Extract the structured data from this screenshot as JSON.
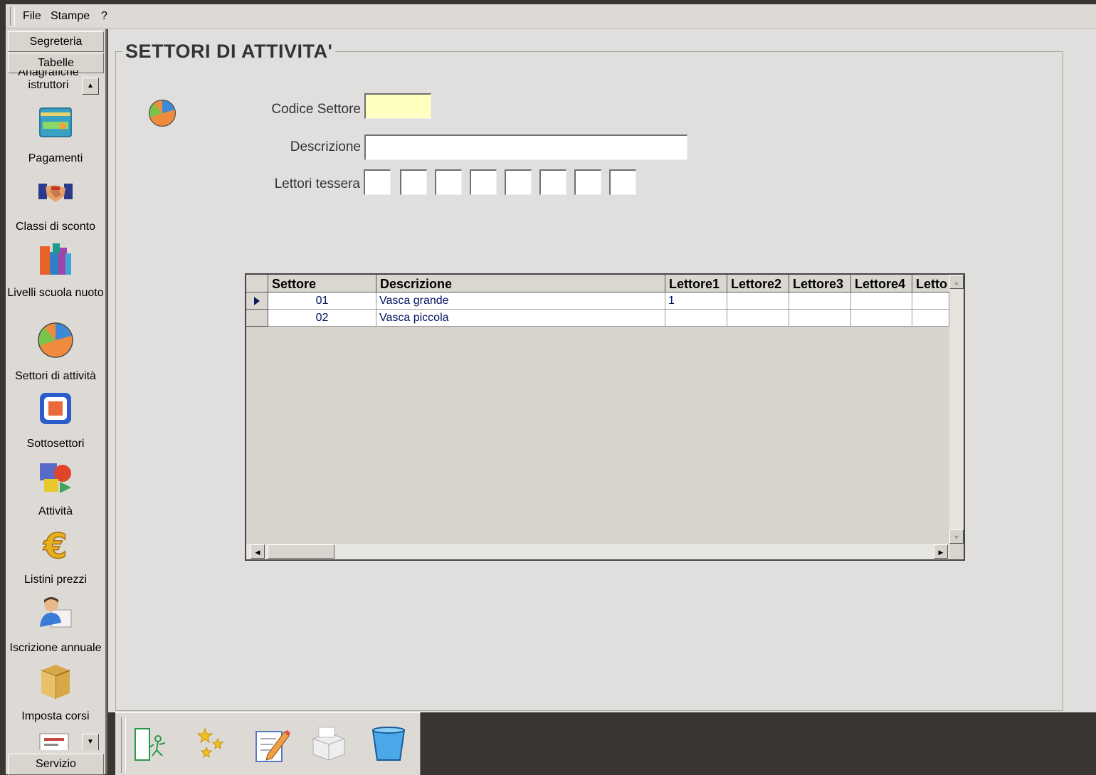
{
  "menu": {
    "items": [
      "File",
      "Stampe",
      "?"
    ]
  },
  "sidebar": {
    "top_groups": [
      "Segreteria",
      "Tabelle"
    ],
    "partial_item": "Anagrafiche istruttori",
    "items": [
      {
        "label": "Pagamenti",
        "icon": "credit-card-icon"
      },
      {
        "label": "Classi di sconto",
        "icon": "handshake-icon"
      },
      {
        "label": "Livelli scuola nuoto",
        "icon": "books-icon"
      },
      {
        "label": "Settori di attività",
        "icon": "pie-chart-icon"
      },
      {
        "label": "Sottosettori",
        "icon": "refresh-box-icon"
      },
      {
        "label": "Attività",
        "icon": "shapes-icon"
      },
      {
        "label": "Listini prezzi",
        "icon": "euro-icon"
      },
      {
        "label": "Iscrizione annuale",
        "icon": "user-card-icon"
      },
      {
        "label": "Imposta corsi",
        "icon": "box-icon"
      }
    ],
    "bottom_group": "Servizio"
  },
  "form": {
    "title": "SETTORI DI ATTIVITA'",
    "code_label": "Codice Settore",
    "code_value": "",
    "desc_label": "Descrizione",
    "desc_value": "",
    "readers_label": "Lettori tessera"
  },
  "grid": {
    "columns": [
      "Settore",
      "Descrizione",
      "Lettore1",
      "Lettore2",
      "Lettore3",
      "Lettore4",
      "Letto"
    ],
    "rows": [
      [
        "01",
        "Vasca grande",
        "1",
        "",
        "",
        "",
        ""
      ],
      [
        "02",
        "Vasca piccola",
        "",
        "",
        "",
        "",
        ""
      ]
    ]
  },
  "toolbar": {
    "buttons": [
      "exit-icon",
      "new-icon",
      "edit-icon",
      "print-icon",
      "delete-icon"
    ]
  }
}
